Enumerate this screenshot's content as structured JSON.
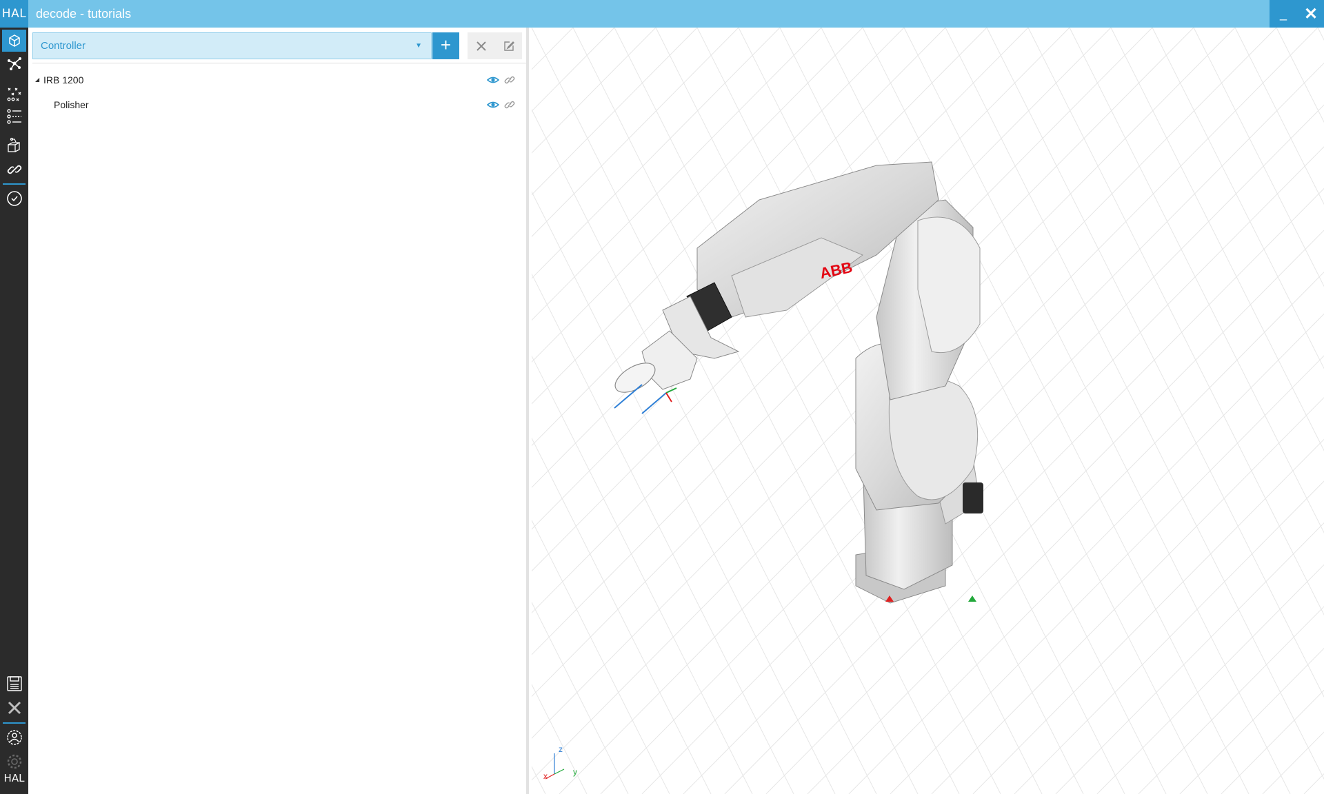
{
  "window": {
    "logo": "HAL",
    "title": "decode - tutorials",
    "minimize_label": "_",
    "close_label": "✕"
  },
  "toolbar": {
    "items": [
      {
        "icon": "cube-icon",
        "active": true
      },
      {
        "icon": "nodes-icon"
      },
      {
        "icon": "axes-icon"
      },
      {
        "icon": "list-icon"
      },
      {
        "icon": "robot-cell-icon"
      },
      {
        "icon": "link-icon"
      },
      {
        "icon": "check-circle-icon"
      },
      {
        "icon": "save-icon"
      },
      {
        "icon": "close-icon"
      },
      {
        "icon": "user-icon"
      },
      {
        "icon": "gear-icon"
      }
    ],
    "logo": "HAL"
  },
  "panel": {
    "selector": {
      "value": "Controller",
      "arrow": "▼"
    },
    "add_label": "+",
    "tree": [
      {
        "label": "IRB 1200",
        "expanded": true,
        "visible": true
      },
      {
        "label": "Polisher",
        "visible": true
      }
    ]
  },
  "viewport": {
    "logo_text": "ABB",
    "axis_labels": {
      "z": "z",
      "y": "y",
      "x": "x"
    },
    "colors": {
      "x": "#e02020",
      "y": "#22a83a",
      "z": "#2e7fd6",
      "grid": "#e4e4e4"
    }
  },
  "colors": {
    "accent": "#2e97cf",
    "titlebar": "#74c4e9",
    "sidebar": "#2b2b2b",
    "selector_bg": "#d2ecf8"
  }
}
